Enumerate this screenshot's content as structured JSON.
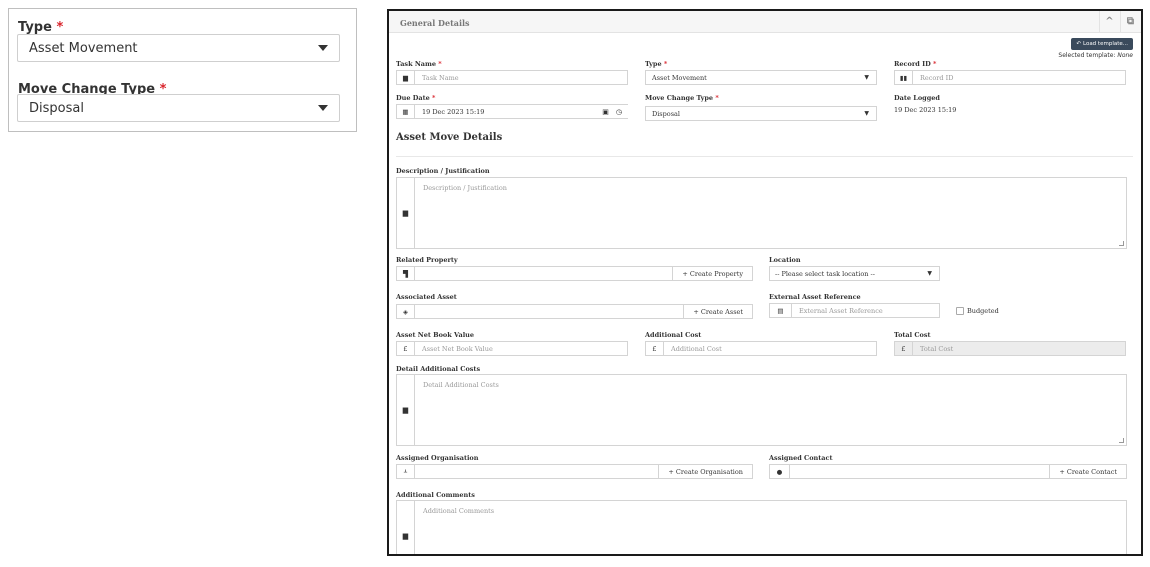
{
  "zoom": {
    "type_label": "Type",
    "type_value": "Asset Movement",
    "move_change_label": "Move Change Type",
    "move_change_value": "Disposal",
    "required_mark": "*"
  },
  "window": {
    "title": "General Details",
    "collapse_icon": "^",
    "popout_icon": "⧉",
    "load_template_label": "Load template...",
    "selected_template_prefix": "Selected template:",
    "selected_template_value": "None"
  },
  "form": {
    "task_name": {
      "label": "Task Name",
      "placeholder": "Task Name"
    },
    "type": {
      "label": "Type",
      "value": "Asset Movement"
    },
    "record_id": {
      "label": "Record ID",
      "placeholder": "Record ID"
    },
    "due_date": {
      "label": "Due Date",
      "value": "19 Dec 2023 15:19"
    },
    "move_change_type": {
      "label": "Move Change Type",
      "value": "Disposal"
    },
    "date_logged": {
      "label": "Date Logged",
      "value": "19 Dec 2023 15:19"
    },
    "section_title": "Asset Move Details",
    "description": {
      "label": "Description / Justification",
      "placeholder": "Description / Justification"
    },
    "related_property": {
      "label": "Related Property",
      "button": "+ Create Property"
    },
    "location": {
      "label": "Location",
      "value": "-- Please select task location --"
    },
    "associated_asset": {
      "label": "Associated Asset",
      "button": "+ Create Asset"
    },
    "external_asset_ref": {
      "label": "External Asset Reference",
      "placeholder": "External Asset Reference"
    },
    "budgeted": {
      "label": "Budgeted"
    },
    "asset_nbv": {
      "label": "Asset Net Book Value",
      "placeholder": "Asset Net Book Value",
      "currency": "£"
    },
    "additional_cost": {
      "label": "Additional Cost",
      "placeholder": "Additional Cost",
      "currency": "£"
    },
    "total_cost": {
      "label": "Total Cost",
      "placeholder": "Total Cost",
      "currency": "£"
    },
    "detail_additional_costs": {
      "label": "Detail Additional Costs",
      "placeholder": "Detail Additional Costs"
    },
    "assigned_org": {
      "label": "Assigned Organisation",
      "button": "+ Create Organisation"
    },
    "assigned_contact": {
      "label": "Assigned Contact",
      "button": "+ Create Contact"
    },
    "additional_comments": {
      "label": "Additional Comments",
      "placeholder": "Additional Comments"
    },
    "required_mark": "*"
  },
  "colors": {
    "required": "#d9242c",
    "load_button": "#3a4a5c",
    "disabled_field": "#ececec"
  }
}
